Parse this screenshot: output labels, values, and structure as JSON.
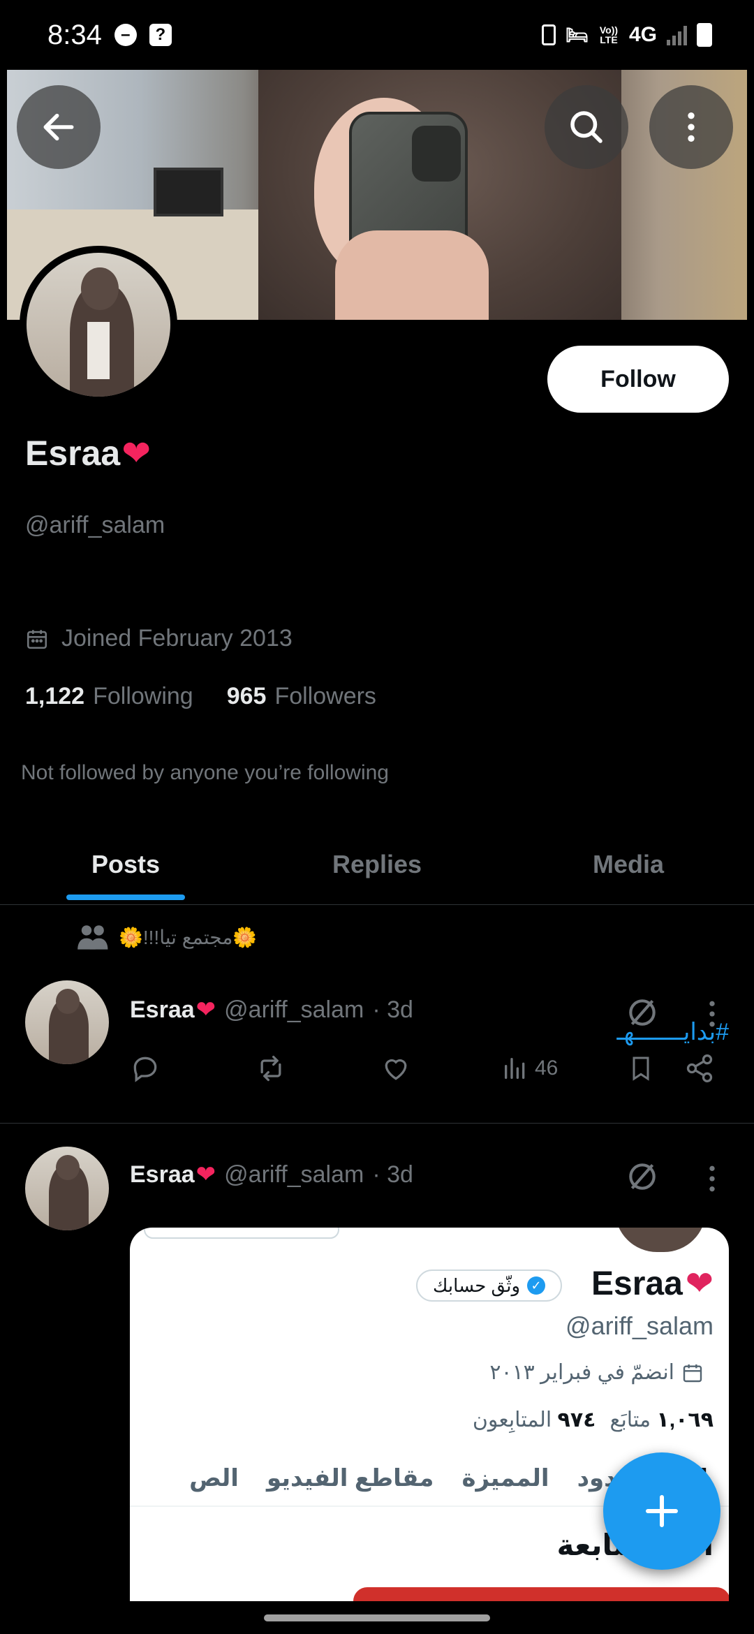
{
  "status_bar": {
    "time": "8:34",
    "network": "4G",
    "volte": "Vo)) LTE"
  },
  "profile": {
    "display_name": "Esraa",
    "heart": "❤",
    "handle": "@ariff_salam",
    "joined": "Joined February 2013",
    "following_count": "1,122",
    "following_label": "Following",
    "followers_count": "965",
    "followers_label": "Followers",
    "not_followed": "Not followed by anyone you’re following",
    "follow_label": "Follow"
  },
  "tabs": [
    {
      "label": "Posts",
      "active": true
    },
    {
      "label": "Replies",
      "active": false
    },
    {
      "label": "Media",
      "active": false
    }
  ],
  "community": {
    "label": "🌼مجتمع تيا!!!🌼"
  },
  "posts": [
    {
      "name": "Esraa",
      "heart": "❤",
      "handle": "@ariff_salam",
      "time": "· 3d",
      "text": "#بدايـــــــهـ",
      "views": "46"
    },
    {
      "name": "Esraa",
      "heart": "❤",
      "handle": "@ariff_salam",
      "time": "· 3d"
    }
  ],
  "embedded": {
    "name": "Esraa",
    "heart": "❤",
    "verify_label": "وثّق حسابك",
    "handle": "@ariff_salam",
    "joined": "انضمّ في فبراير ٢٠١٣",
    "following": "١,٠٦٩",
    "following_label": "متابَع",
    "followers": "٩٧٤",
    "followers_label": "المتابِعون",
    "tabs": [
      "ات",
      "الردود",
      "المميزة",
      "مقاطع الفيديو",
      "الص"
    ],
    "section_title": "ات المتابعة"
  },
  "colors": {
    "accent": "#1d9bf0",
    "heart": "#f4245e",
    "muted": "#71767b",
    "text": "#e7e9ea",
    "background": "#000000"
  }
}
